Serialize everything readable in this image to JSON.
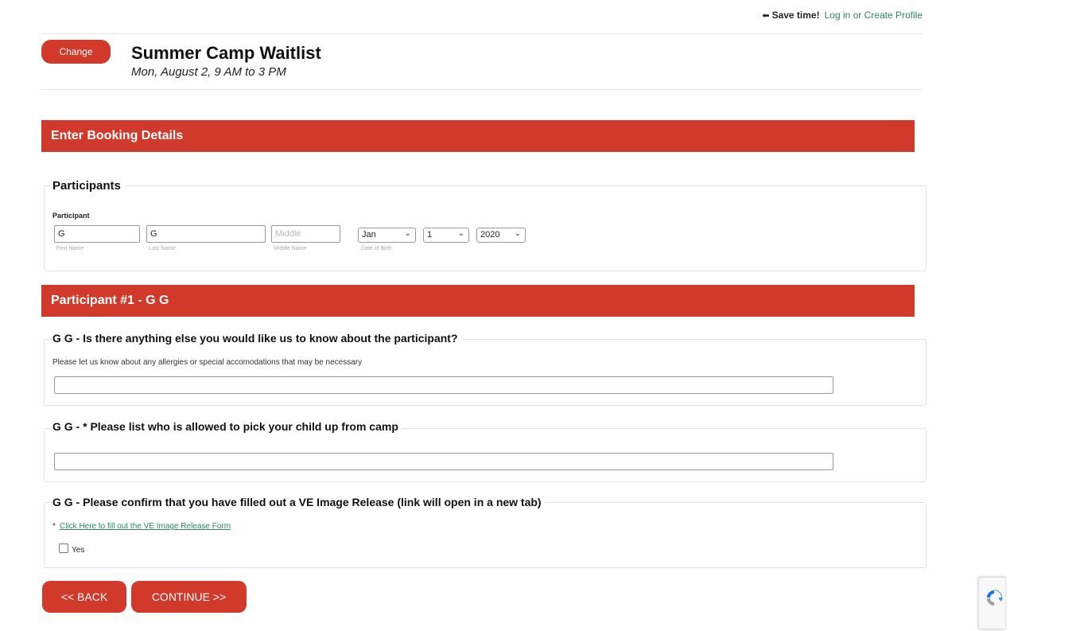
{
  "topbar": {
    "save_label": "Save time!",
    "login_link": "Log in or Create Profile"
  },
  "event": {
    "change_label": "Change",
    "title": "Summer Camp Waitlist",
    "date": "Mon, August 2, 9 AM to 3 PM"
  },
  "booking_section": {
    "title": "Enter Booking Details"
  },
  "participants": {
    "legend": "Participants",
    "participant_label": "Participant",
    "first_name_value": "G",
    "first_name_label": "First Name",
    "last_name_value": "G",
    "last_name_label": "Last Name",
    "middle_name_placeholder": "Middle",
    "middle_name_label": "Middle Name",
    "dob_month": "Jan",
    "dob_day": "1",
    "dob_year": "2020",
    "dob_label": "Date of Birth"
  },
  "participant_section": {
    "title": "Participant #1 - G G"
  },
  "questions": {
    "q1_legend": "G G - Is there anything else you would like us to know about the participant?",
    "q1_hint": "Please let us know about any allergies or special accomodations that may be necessary",
    "q2_legend": "G G - * Please list who is allowed to pick your child up from camp",
    "q3_legend": "G G - Please confirm that you have filled out a VE Image Release (link will open in a new tab)",
    "q3_required": "*",
    "q3_link": "Click Here to fill out the VE Image Release Form",
    "q3_checkbox_label": "Yes"
  },
  "nav": {
    "back_label": "<< BACK",
    "continue_label": "CONTINUE >>"
  },
  "colors": {
    "accent": "#d1392b",
    "link": "#2a8a5e"
  }
}
